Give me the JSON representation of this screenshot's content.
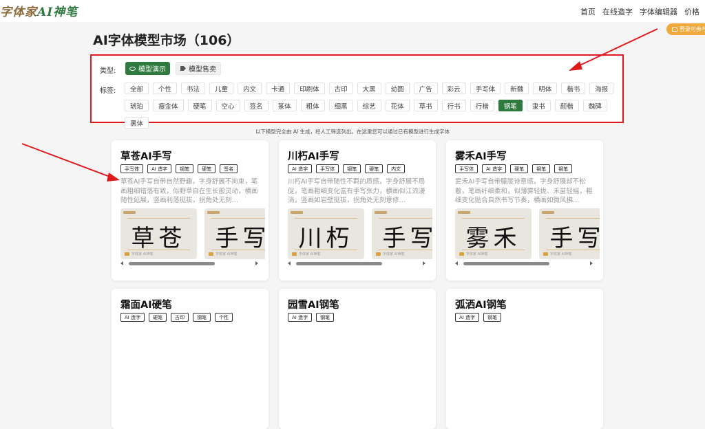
{
  "header": {
    "logo_part1": "字体家",
    "logo_part2": "AI神笔",
    "nav": [
      "首页",
      "在线造字",
      "字体编辑器",
      "价格"
    ]
  },
  "login_button": "登录可参与",
  "page_title": "AI字体模型市场（106）",
  "filter": {
    "type_label": "类型:",
    "type_options": [
      {
        "label": "模型演示",
        "active": true
      },
      {
        "label": "模型售卖",
        "active": false
      }
    ],
    "tag_label": "标签:",
    "tags": [
      "全部",
      "个性",
      "书法",
      "儿童",
      "内文",
      "卡通",
      "印刷体",
      "古印",
      "大黑",
      "幼圆",
      "广告",
      "彩云",
      "手写体",
      "新魏",
      "明体",
      "楷书",
      "海报",
      "琥珀",
      "瘦金体",
      "硬笔",
      "空心",
      "签名",
      "篆体",
      "粗体",
      "细黑",
      "综艺",
      "花体",
      "草书",
      "行书",
      "行楷",
      "钢笔",
      "隶书",
      "颜楷",
      "魏碑",
      "黑体"
    ],
    "active_tag": "钢笔"
  },
  "note": "以下模型完全由 AI 生成，经人工筛选列出。在这里您可以通过已有模型进行生成字体",
  "cards": [
    {
      "title": "草苍AI手写",
      "chips": [
        "手写体",
        "AI 造字",
        "钢笔",
        "硬笔",
        "签名"
      ],
      "desc": "草苍AI手写自带自然野趣，字身舒展不拘束，笔画粗细错落有致，似野草自在生长般灵动，横画随性延展，竖画利落挺拔，拐角处无刻…",
      "glyph1": "草苍",
      "glyph2": "手写"
    },
    {
      "title": "川朽AI手写",
      "chips": [
        "AI 造字",
        "手写体",
        "钢笔",
        "硬笔",
        "内文"
      ],
      "desc": "川朽AI手写自带随性不羁的质感，字身舒展不局促，笔画粗细变化富有手写张力，横画似江流漫淌，竖画如岩壁挺拔，拐角处无刻意修…",
      "glyph1": "川朽",
      "glyph2": "手写"
    },
    {
      "title": "雾禾AI手写",
      "chips": [
        "手写体",
        "AI 造字",
        "硬笔",
        "钢笔",
        "钢笔"
      ],
      "desc": "雾禾AI手写自带朦胧诗意感，字身舒展却不松散，笔画纤细柔和，似薄雾轻拢、禾苗轻摇，粗细变化贴合自然书写节奏，横画如微风拂…",
      "glyph1": "雾禾",
      "glyph2": "手写"
    },
    {
      "title": "霜面AI硬笔",
      "chips": [
        "AI 造字",
        "硬笔",
        "古印",
        "钢笔",
        "个性"
      ],
      "desc": "",
      "glyph1": "",
      "glyph2": ""
    },
    {
      "title": "园雪AI钢笔",
      "chips": [
        "AI 造字",
        "钢笔"
      ],
      "desc": "",
      "glyph1": "",
      "glyph2": ""
    },
    {
      "title": "弧洒AI钢笔",
      "chips": [
        "AI 造字",
        "钢笔"
      ],
      "desc": "",
      "glyph1": "",
      "glyph2": ""
    }
  ],
  "thumb_caption": "字体家 AI神笔"
}
